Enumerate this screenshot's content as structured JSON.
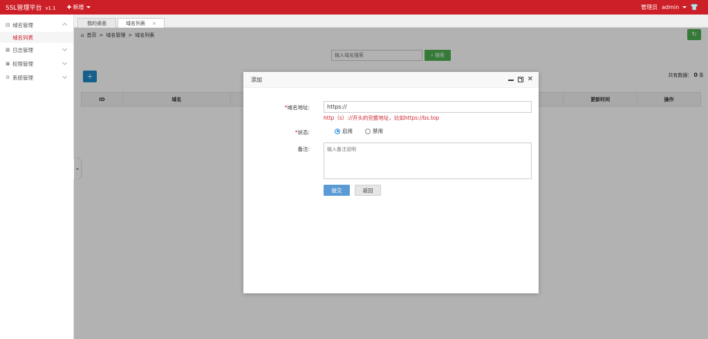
{
  "app": {
    "title": "SSL管理平台",
    "version": "v1.1",
    "new_label": "新增",
    "user_role": "管理员",
    "user_name": "admin"
  },
  "sidebar": {
    "items": [
      {
        "label": "域名管理",
        "icon": "domain-icon",
        "expanded": true
      },
      {
        "label": "日志管理",
        "icon": "log-icon",
        "expanded": false
      },
      {
        "label": "权限管理",
        "icon": "permission-icon",
        "expanded": false
      },
      {
        "label": "系统管理",
        "icon": "gear-icon",
        "expanded": false
      }
    ],
    "sub_items": [
      {
        "label": "域名列表",
        "active": true
      }
    ]
  },
  "tabs": [
    {
      "label": "我的桌面"
    },
    {
      "label": "域名列表",
      "closable": true
    }
  ],
  "breadcrumb": [
    "首页",
    "域名管理",
    "域名列表"
  ],
  "search": {
    "placeholder": "输入域名搜索",
    "button_label": "搜索"
  },
  "toolbar": {
    "add_label": "+",
    "count_prefix": "共有数据：",
    "count_value": "0",
    "count_suffix": "条"
  },
  "table": {
    "headers": [
      "ID",
      "域名",
      "更新时间",
      "操作"
    ]
  },
  "dialog": {
    "title": "添加",
    "url_label": "域名地址:",
    "url_value": "https://",
    "url_hint": "http（s）://开头的完整地址，比如https://bs.top",
    "status_label": "状态:",
    "status_options": [
      {
        "label": "启用",
        "checked": true
      },
      {
        "label": "禁用",
        "checked": false
      }
    ],
    "note_label": "备注:",
    "note_placeholder": "输入备注说明",
    "submit_label": "提交",
    "back_label": "返回"
  },
  "colors": {
    "brand_red": "#cd1f27",
    "primary_blue": "#1e88c8",
    "success_green": "#4caf50"
  }
}
